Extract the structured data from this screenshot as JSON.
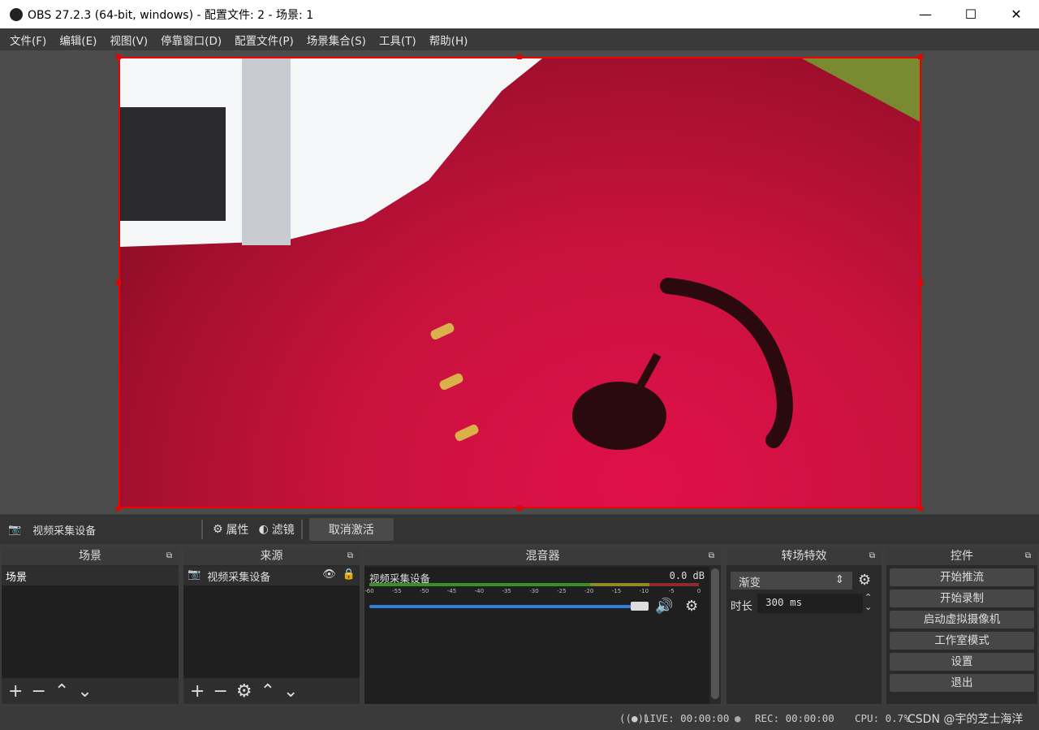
{
  "window": {
    "title": "OBS 27.2.3 (64-bit, windows) - 配置文件: 2 - 场景: 1",
    "minimize": "—",
    "maximize": "☐",
    "close": "✕"
  },
  "menu": [
    "文件(F)",
    "编辑(E)",
    "视图(V)",
    "停靠窗口(D)",
    "配置文件(P)",
    "场景集合(S)",
    "工具(T)",
    "帮助(H)"
  ],
  "source_toolbar": {
    "source_name": "视频采集设备",
    "properties": "属性",
    "filters": "滤镜",
    "deactivate": "取消激活"
  },
  "docks": {
    "scenes": {
      "title": "场景",
      "items": [
        "场景"
      ]
    },
    "sources": {
      "title": "来源",
      "items": [
        "视频采集设备"
      ]
    },
    "mixer": {
      "title": "混音器",
      "channel": "视频采集设备",
      "level": "0.0 dB",
      "ticks": [
        "-60",
        "-55",
        "-50",
        "-45",
        "-40",
        "-35",
        "-30",
        "-25",
        "-20",
        "-15",
        "-10",
        "-5",
        "0"
      ],
      "volume_percent": 100
    },
    "transitions": {
      "title": "转场特效",
      "selected": "渐变",
      "duration_label": "时长",
      "duration": "300 ms"
    },
    "controls": {
      "title": "控件",
      "buttons": [
        "开始推流",
        "开始录制",
        "启动虚拟摄像机",
        "工作室模式",
        "设置",
        "退出"
      ]
    }
  },
  "status": {
    "live": "LIVE: 00:00:00",
    "rec": "REC: 00:00:00",
    "cpu": "CPU: 0.7%",
    "watermark": "CSDN @宇的芝士海洋"
  }
}
